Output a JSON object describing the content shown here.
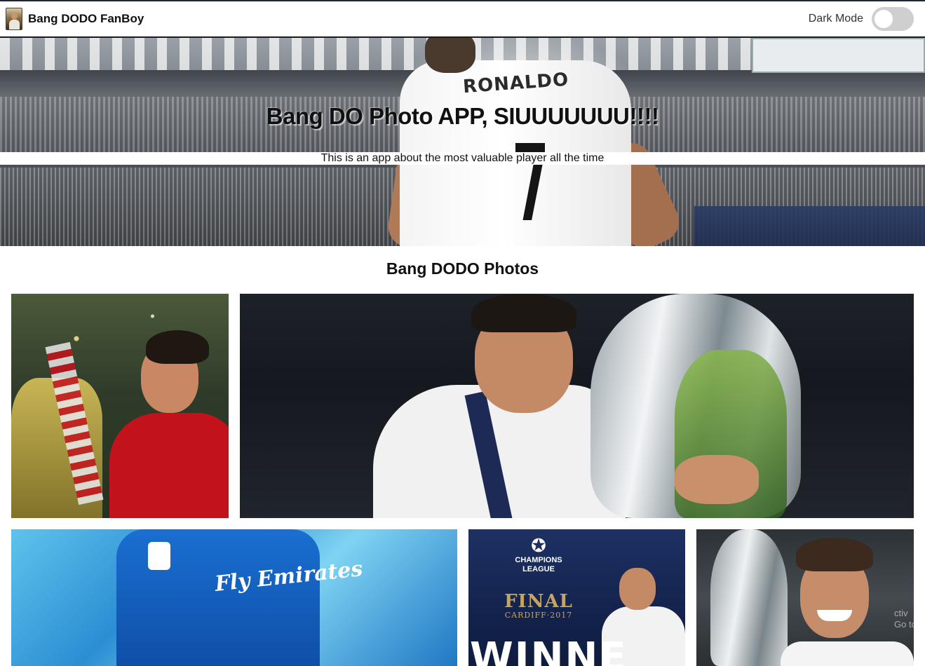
{
  "navbar": {
    "brand_title": "Bang DODO FanBoy",
    "dark_mode_label": "Dark Mode",
    "dark_mode_enabled": false
  },
  "hero": {
    "title": "Bang DO Photo APP, SIUUUUUUU!!!!",
    "subtitle": "This is an app about the most valuable player all the time",
    "shirt_name": "RONALDO"
  },
  "gallery": {
    "heading": "Bang DODO Photos",
    "photos": [
      {
        "alt": "Ronaldo celebrating with Manchester United trophy"
      },
      {
        "alt": "Ronaldo kissing the Champions League trophy"
      },
      {
        "alt": "Ronaldo in Real Madrid blue kit",
        "jersey_text": "Fly Emirates"
      },
      {
        "alt": "Champions League Final Cardiff 2017 winner",
        "league_line1": "CHAMPIONS",
        "league_line2": "LEAGUE",
        "final_text": "FINAL",
        "venue_text": "CARDIFF·2017",
        "winner_text": "WINNE"
      },
      {
        "alt": "Ronaldo smiling with trophy",
        "watermark": "ctiv\nGo to"
      }
    ]
  },
  "colors": {
    "navbar_border": "#1a1a1a",
    "toggle_track": "#cfcfcf",
    "toggle_knob": "#ffffff",
    "page_background": "#ffffff"
  },
  "icons": {
    "brand_logo": "player-card-image",
    "dark_mode_toggle": "toggle-switch",
    "ucl_star": "star-ball-icon"
  }
}
